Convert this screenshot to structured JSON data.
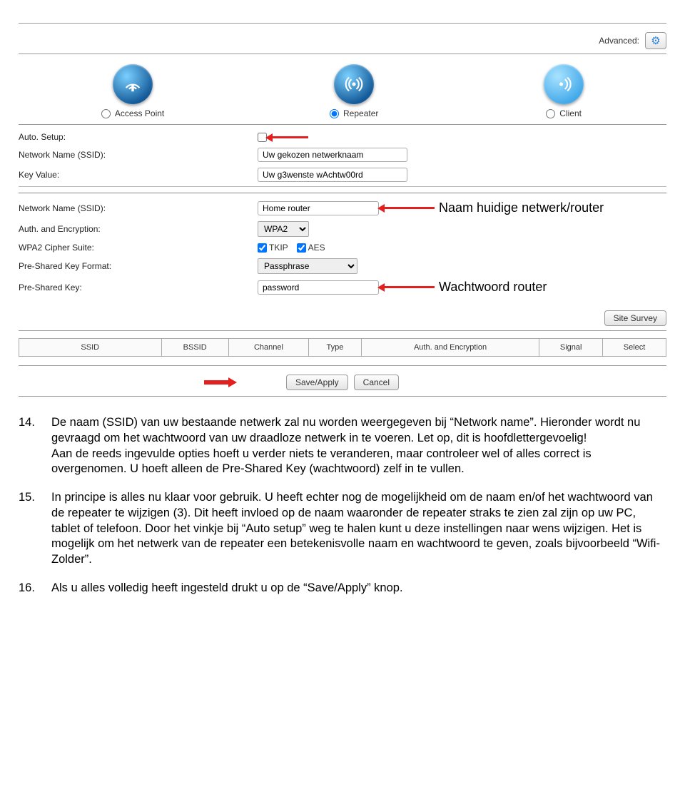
{
  "advanced": {
    "label": "Advanced:"
  },
  "modes": {
    "ap": {
      "label": "Access Point",
      "checked": false
    },
    "repeater": {
      "label": "Repeater",
      "checked": true
    },
    "client": {
      "label": "Client",
      "checked": false
    }
  },
  "upper": {
    "auto_setup_label": "Auto. Setup:",
    "ssid_label": "Network Name (SSID):",
    "ssid_value": "Uw gekozen netwerknaam",
    "key_label": "Key Value:",
    "key_value": "Uw g3wenste wAchtw00rd"
  },
  "lower": {
    "ssid_label": "Network Name (SSID):",
    "ssid_value": "Home router",
    "auth_label": "Auth. and Encryption:",
    "auth_value": "WPA2",
    "cipher_label": "WPA2 Cipher Suite:",
    "tkip": "TKIP",
    "aes": "AES",
    "psk_format_label": "Pre-Shared Key Format:",
    "psk_format_value": "Passphrase",
    "psk_label": "Pre-Shared Key:",
    "psk_value": "password"
  },
  "annotations": {
    "ssid": "Naam huidige netwerk/router",
    "psk": "Wachtwoord  router"
  },
  "buttons": {
    "site_survey": "Site Survey",
    "save": "Save/Apply",
    "cancel": "Cancel"
  },
  "survey_headers": [
    "SSID",
    "BSSID",
    "Channel",
    "Type",
    "Auth. and Encryption",
    "Signal",
    "Select"
  ],
  "instructions": {
    "i14": {
      "num": "14.",
      "text": "De naam (SSID) van uw bestaande netwerk zal nu worden weergegeven bij “Network name”. Hieronder wordt nu gevraagd om het wachtwoord van uw draadloze netwerk in te voeren. Let op, dit is hoofdlettergevoelig!\nAan de reeds ingevulde opties hoeft u verder niets te veranderen, maar controleer wel of alles correct is overgenomen. U hoeft alleen de Pre-Shared Key (wachtwoord) zelf in te vullen."
    },
    "i15": {
      "num": "15.",
      "text": "In principe is alles nu klaar voor gebruik. U heeft echter nog de mogelijkheid om de naam en/of het wachtwoord van de repeater te wijzigen (3). Dit heeft invloed op de naam waaronder de repeater straks te zien zal zijn op uw PC, tablet of telefoon. Door het vinkje bij “Auto setup” weg te halen kunt u deze instellingen naar wens wijzigen. Het is mogelijk om het netwerk van de repeater een betekenisvolle naam en wachtwoord te geven, zoals bijvoorbeeld “Wifi-Zolder”."
    },
    "i16": {
      "num": "16.",
      "text": "Als u alles volledig heeft ingesteld drukt u op de “Save/Apply” knop."
    }
  }
}
